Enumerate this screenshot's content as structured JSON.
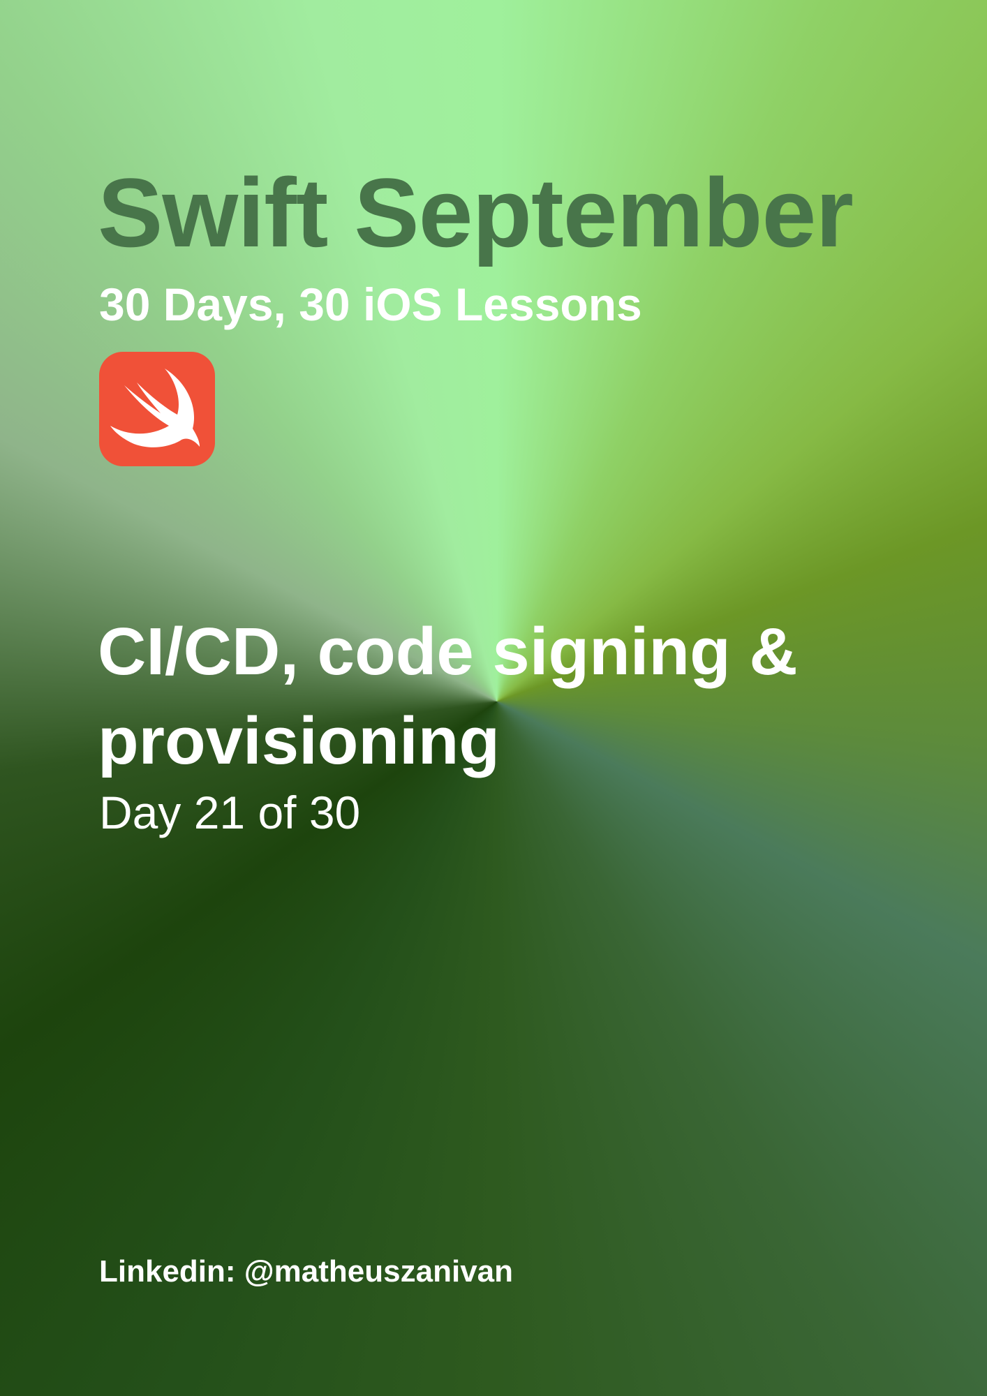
{
  "page": {
    "title": "Swift September",
    "subtitle": "30 Days, 30 iOS Lessons",
    "logo_icon": "swift-bird-icon",
    "topic": "CI/CD, code signing & provisioning",
    "progress": {
      "text": "Day 21 of 30",
      "current_day": 21,
      "total_days": 30
    },
    "social": "Linkedin: @matheuszanivan"
  },
  "colors": {
    "title": "#48754a",
    "text": "#ffffff",
    "logo_background": "#f05138",
    "background_light": "#9ff09c",
    "background_dark": "#1d440d"
  }
}
